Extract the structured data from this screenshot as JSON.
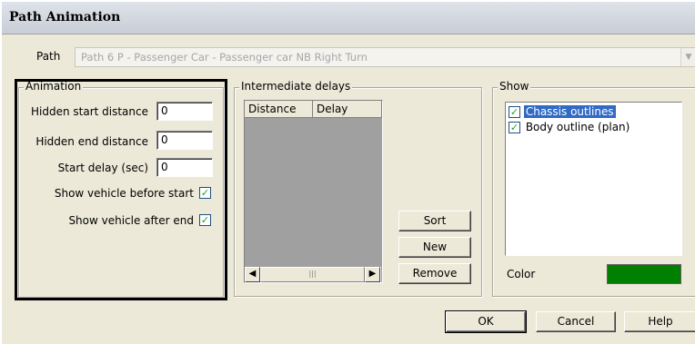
{
  "window": {
    "title": "Path Animation"
  },
  "path": {
    "label": "Path",
    "value": "Path 6 P - Passenger Car - Passenger car NB Right Turn",
    "dropdown_icon": "chevron-down-icon"
  },
  "animation": {
    "legend": "Animation",
    "hidden_start_label": "Hidden start distance",
    "hidden_start_value": "0",
    "hidden_end_label": "Hidden end distance",
    "hidden_end_value": "0",
    "start_delay_label": "Start delay (sec)",
    "start_delay_value": "0",
    "show_before_label": "Show vehicle before start",
    "show_before_checked": true,
    "show_after_label": "Show vehicle after end",
    "show_after_checked": true
  },
  "delays": {
    "legend": "Intermediate delays",
    "columns": [
      "Distance",
      "Delay"
    ],
    "rows": [],
    "scroll_left_icon": "scroll-left-icon",
    "scroll_right_icon": "scroll-right-icon",
    "sort_label": "Sort",
    "new_label": "New",
    "remove_label": "Remove"
  },
  "show": {
    "legend": "Show",
    "items": [
      {
        "label": "Chassis outlines",
        "checked": true,
        "selected": true
      },
      {
        "label": "Body outline (plan)",
        "checked": true,
        "selected": false
      }
    ],
    "color_label": "Color",
    "color_value": "#008000"
  },
  "footer": {
    "ok_label": "OK",
    "cancel_label": "Cancel",
    "help_label": "Help"
  },
  "glyphs": {
    "check": "✓",
    "scroll_left": "◀",
    "scroll_right": "▶",
    "thumb_grip": "|||",
    "dropdown": "▼"
  }
}
